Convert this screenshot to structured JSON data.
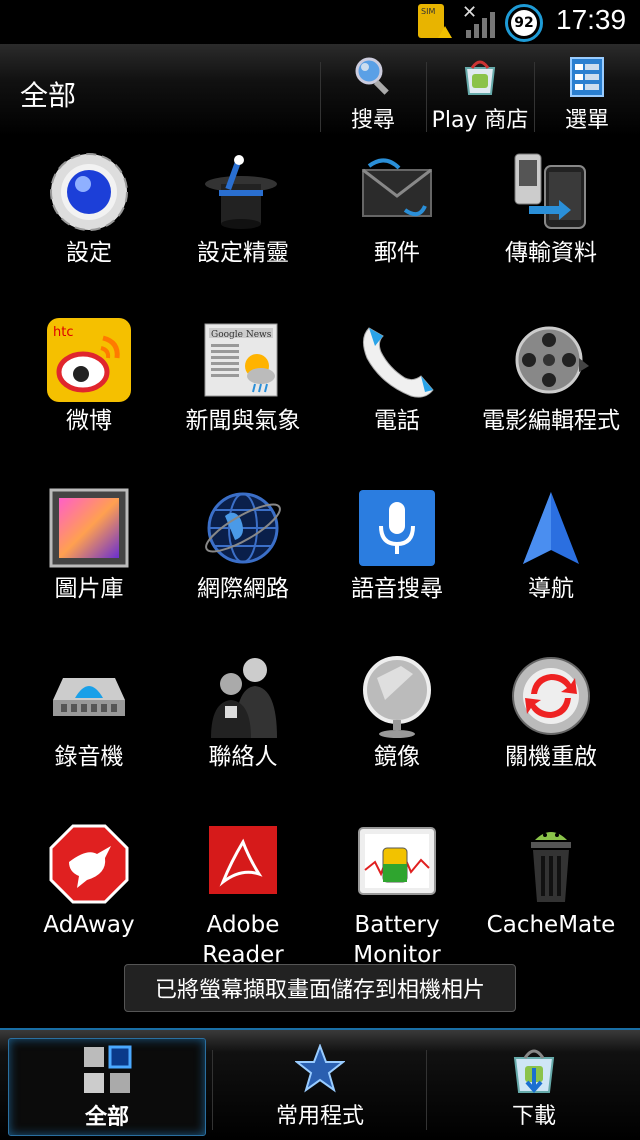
{
  "status_bar": {
    "sim_label": "SIM",
    "battery_level": "92",
    "time": "17:39"
  },
  "header": {
    "title": "全部",
    "buttons": [
      {
        "label": "搜尋",
        "icon": "search-icon"
      },
      {
        "label": "Play 商店",
        "icon": "play-store-icon"
      },
      {
        "label": "選單",
        "icon": "menu-icon"
      }
    ]
  },
  "apps": [
    {
      "label": "設定",
      "icon": "settings-icon"
    },
    {
      "label": "設定精靈",
      "icon": "setup-wizard-icon"
    },
    {
      "label": "郵件",
      "icon": "mail-icon"
    },
    {
      "label": "傳輸資料",
      "icon": "transfer-data-icon"
    },
    {
      "label": "微博",
      "icon": "weibo-icon"
    },
    {
      "label": "新聞與氣象",
      "icon": "news-weather-icon"
    },
    {
      "label": "電話",
      "icon": "phone-icon"
    },
    {
      "label": "電影編輯程式",
      "icon": "movie-editor-icon"
    },
    {
      "label": "圖片庫",
      "icon": "gallery-icon"
    },
    {
      "label": "網際網路",
      "icon": "internet-icon"
    },
    {
      "label": "語音搜尋",
      "icon": "voice-search-icon"
    },
    {
      "label": "導航",
      "icon": "navigation-icon"
    },
    {
      "label": "錄音機",
      "icon": "recorder-icon"
    },
    {
      "label": "聯絡人",
      "icon": "contacts-icon"
    },
    {
      "label": "鏡像",
      "icon": "mirror-icon"
    },
    {
      "label": "關機重啟",
      "icon": "reboot-icon"
    },
    {
      "label": "AdAway",
      "icon": "adaway-icon"
    },
    {
      "label": "Adobe Reader",
      "icon": "adobe-reader-icon"
    },
    {
      "label": "Battery Monitor",
      "icon": "battery-monitor-icon"
    },
    {
      "label": "CacheMate",
      "icon": "cachemate-icon"
    }
  ],
  "toast": "已將螢幕擷取畫面儲存到相機相片",
  "bottom_tabs": [
    {
      "label": "全部",
      "icon": "all-apps-icon",
      "active": true
    },
    {
      "label": "常用程式",
      "icon": "favorites-star-icon",
      "active": false
    },
    {
      "label": "下載",
      "icon": "downloads-icon",
      "active": false
    }
  ],
  "colors": {
    "accent": "#1e9bd6",
    "background": "#000000"
  }
}
